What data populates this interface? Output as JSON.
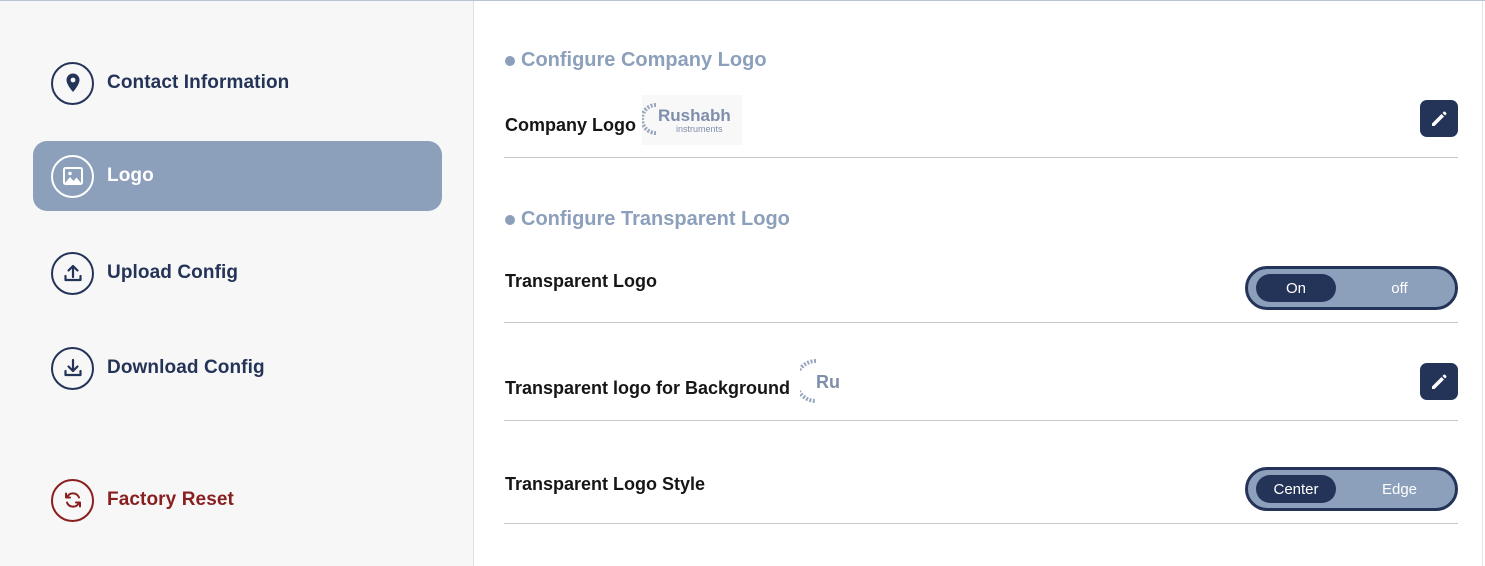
{
  "sidebar": {
    "items": [
      {
        "label": "Contact Information",
        "icon": "location-pin-icon",
        "active": false
      },
      {
        "label": "Logo",
        "icon": "image-icon",
        "active": true
      },
      {
        "label": "Upload Config",
        "icon": "upload-icon",
        "active": false
      },
      {
        "label": "Download Config",
        "icon": "download-icon",
        "active": false
      },
      {
        "label": "Factory Reset",
        "icon": "refresh-icon",
        "active": false
      }
    ]
  },
  "main": {
    "company_logo_section": {
      "title": "Configure Company Logo",
      "row_label": "Company Logo",
      "logo_text": "Rushabh",
      "logo_subtext": "instruments"
    },
    "transparent_section": {
      "title": "Configure Transparent Logo",
      "transparent_logo": {
        "label": "Transparent Logo",
        "options": [
          "On",
          "off"
        ],
        "selected": "On"
      },
      "background_logo": {
        "label": "Transparent logo for Background",
        "logo_text": "Ru"
      },
      "style": {
        "label": "Transparent Logo Style",
        "options": [
          "Center",
          "Edge"
        ],
        "selected": "Center"
      }
    }
  },
  "colors": {
    "navy": "#243358",
    "accent": "#8c9fbb",
    "danger": "#8a1f1f",
    "sidebar_bg": "#f7f7f7"
  }
}
